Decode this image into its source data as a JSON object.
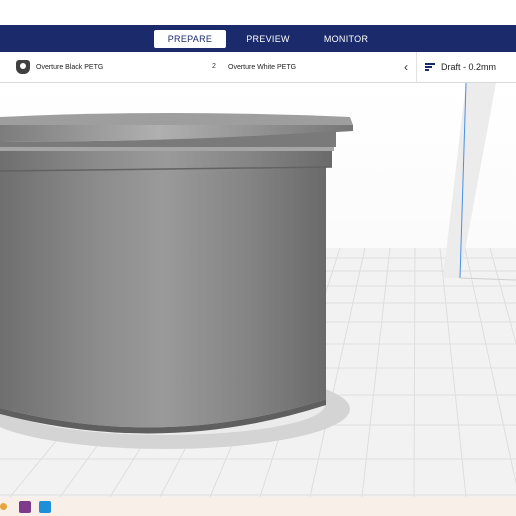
{
  "stage_tabs": [
    {
      "label": "PREPARE",
      "active": true
    },
    {
      "label": "PREVIEW",
      "active": false
    },
    {
      "label": "MONITOR",
      "active": false
    }
  ],
  "extruders": [
    {
      "number": "",
      "material": "Overture Black PETG"
    },
    {
      "number": "2",
      "material": "Overture White PETG"
    }
  ],
  "collapse_icon": "chevron-left",
  "print_profile": {
    "label": "Draft - 0.2mm",
    "icon": "sliders-icon"
  },
  "viewport": {
    "object": "cylinder-model",
    "model_color": "#8a8a8a",
    "plate_color": "#f2f2f2"
  },
  "taskbar": {
    "icons": [
      "app-icon-orange",
      "app-icon-cube",
      "app-icon-blue-c"
    ]
  },
  "colors": {
    "accent": "#1b2a6b",
    "background": "#ffffff"
  }
}
